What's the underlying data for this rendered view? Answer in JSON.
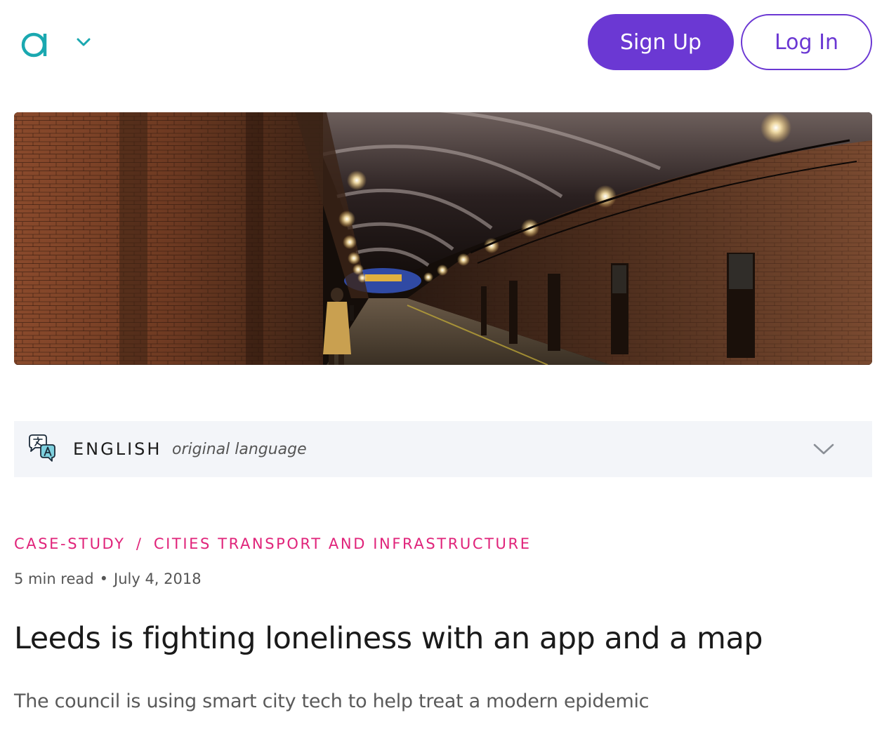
{
  "header": {
    "logo_icon": "app-logo-icon",
    "menu_icon": "chevron-down-icon",
    "signup_label": "Sign Up",
    "login_label": "Log In"
  },
  "hero": {
    "image": "underground brick railway arches tunnel with lamps, woman in yellow coat walking"
  },
  "language": {
    "icon": "translate-icon",
    "name": "ENGLISH",
    "note": "original language",
    "toggle_icon": "chevron-down-icon"
  },
  "article": {
    "category_primary": "CASE-STUDY",
    "category_separator": "/",
    "category_secondary": "CITIES TRANSPORT AND INFRASTRUCTURE",
    "read_time": "5 min read",
    "meta_separator": "•",
    "date": "July 4, 2018",
    "title": "Leeds is fighting loneliness with an app and a map",
    "subtitle": "The council is using smart city tech to help treat a modern epidemic"
  },
  "colors": {
    "brand_teal": "#1aa8b0",
    "brand_purple": "#6b38d3",
    "category_pink": "#e0237a",
    "lang_bar_bg": "#f3f5f9"
  }
}
